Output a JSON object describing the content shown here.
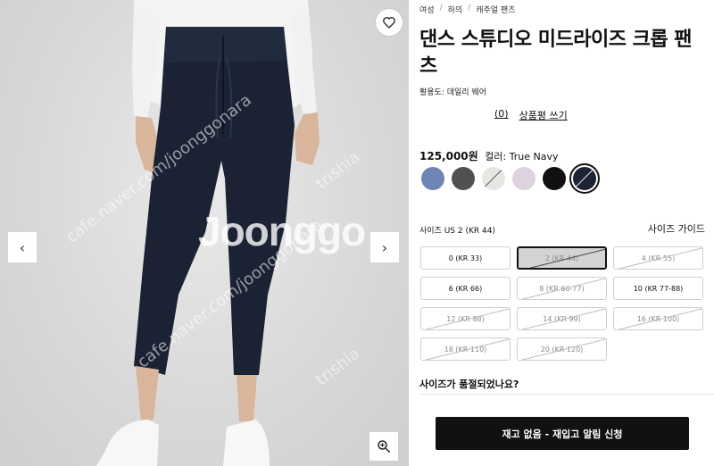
{
  "image": {
    "watermark_main": "Joonggo",
    "watermark_texts": [
      "cafe.naver.com/joonggonara",
      "trishia"
    ]
  },
  "breadcrumb": [
    "여성",
    "하의",
    "캐주얼 팬츠"
  ],
  "product": {
    "title": "댄스 스튜디오 미드라이즈 크롭 팬츠",
    "usage": "활용도: 데일리 웨어",
    "review_count": "(0)",
    "write_review": "상품평 쓰기",
    "price": "125,000원",
    "color_label": "컬러: True Navy"
  },
  "colors": [
    {
      "name": "blue-gray",
      "hex": "#6f86b5",
      "sold_out": false,
      "selected": false
    },
    {
      "name": "charcoal",
      "hex": "#505050",
      "sold_out": false,
      "selected": false
    },
    {
      "name": "light-gray",
      "hex": "#e8e6e2",
      "sold_out": true,
      "selected": false
    },
    {
      "name": "lilac",
      "hex": "#ddd2e0",
      "sold_out": false,
      "selected": false
    },
    {
      "name": "black",
      "hex": "#111111",
      "sold_out": false,
      "selected": false
    },
    {
      "name": "true-navy",
      "hex": "#1c2433",
      "sold_out": true,
      "selected": true
    }
  ],
  "size": {
    "label": "사이즈 US 2 (KR 44)",
    "guide": "사이즈 가이드",
    "options": [
      {
        "label": "0 (KR 33)",
        "sold_out": false,
        "selected": false
      },
      {
        "label": "2 (KR 44)",
        "sold_out": true,
        "selected": true
      },
      {
        "label": "4 (KR 55)",
        "sold_out": true,
        "selected": false
      },
      {
        "label": "6 (KR 66)",
        "sold_out": false,
        "selected": false
      },
      {
        "label": "8 (KR 66-77)",
        "sold_out": true,
        "selected": false
      },
      {
        "label": "10 (KR 77-88)",
        "sold_out": false,
        "selected": false
      },
      {
        "label": "12 (KR 88)",
        "sold_out": true,
        "selected": false
      },
      {
        "label": "14 (KR 99)",
        "sold_out": true,
        "selected": false
      },
      {
        "label": "16 (KR 100)",
        "sold_out": true,
        "selected": false
      },
      {
        "label": "18 (KR 110)",
        "sold_out": true,
        "selected": false
      },
      {
        "label": "20 (KR 120)",
        "sold_out": true,
        "selected": false
      }
    ],
    "question": "사이즈가 품절되었나요?"
  },
  "cta": {
    "label": "재고 없음 - 재입고 알림 신청"
  },
  "icons": {
    "wishlist": "heart-icon",
    "prev": "chevron-left-icon",
    "next": "chevron-right-icon",
    "zoom": "zoom-in-icon"
  }
}
